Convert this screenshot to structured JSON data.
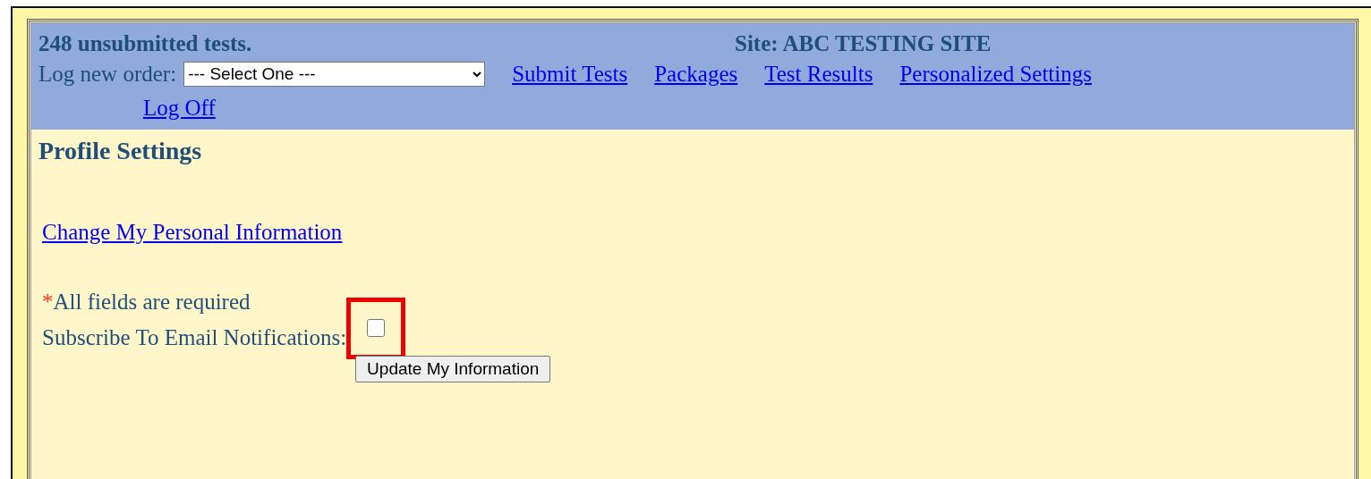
{
  "header": {
    "summary": "248 unsubmitted tests.",
    "site": "Site: ABC TESTING SITE",
    "order_label": "Log new order:",
    "order_select": {
      "value": "--- Select One ---"
    },
    "links": [
      {
        "label": "Submit Tests"
      },
      {
        "label": "Packages"
      },
      {
        "label": "Test Results"
      },
      {
        "label": "Personalized Settings"
      },
      {
        "label": "Log Off"
      }
    ]
  },
  "content": {
    "title": "Profile Settings",
    "link": "Change My Personal Information",
    "required_note": {
      "mark": "*",
      "text": "All fields are required"
    },
    "subscribe": {
      "label": "Subscribe To Email Notifications:",
      "checked": false,
      "highlighted": true
    },
    "button": "Update My Information"
  }
}
